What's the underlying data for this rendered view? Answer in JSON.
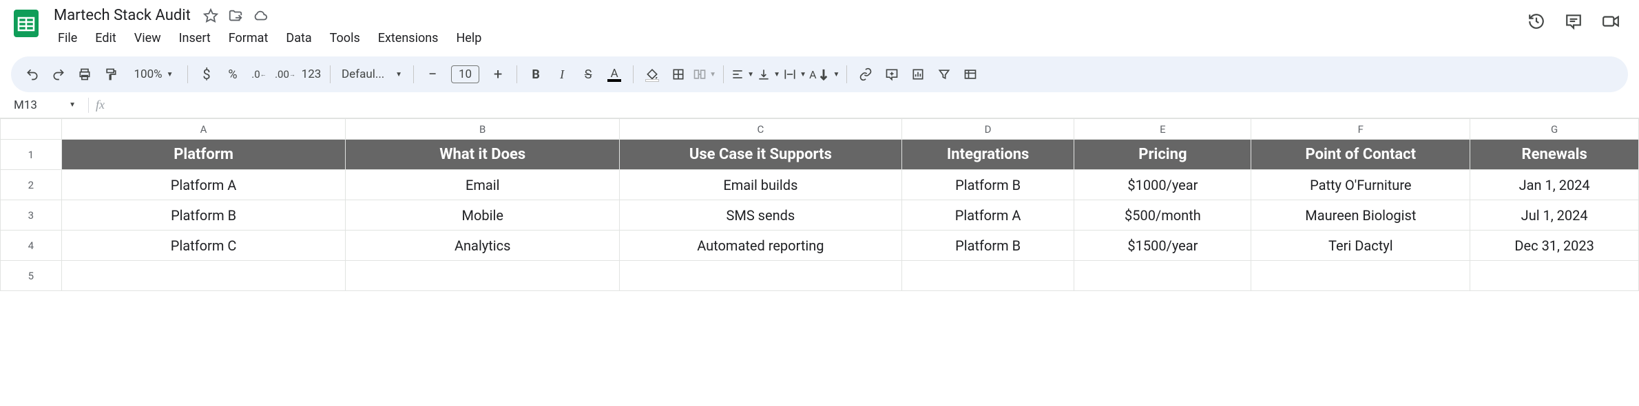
{
  "doc": {
    "title": "Martech Stack Audit"
  },
  "menus": [
    "File",
    "Edit",
    "View",
    "Insert",
    "Format",
    "Data",
    "Tools",
    "Extensions",
    "Help"
  ],
  "toolbar": {
    "zoom": "100%",
    "number_format": "123",
    "font": "Defaul...",
    "font_size": "10"
  },
  "namebox": {
    "cell": "M13"
  },
  "columns": [
    "A",
    "B",
    "C",
    "D",
    "E",
    "F",
    "G"
  ],
  "header_row": [
    "Platform",
    "What it Does",
    "Use Case it Supports",
    "Integrations",
    "Pricing",
    "Point of Contact",
    "Renewals"
  ],
  "rows": [
    {
      "n": "2",
      "cells": [
        "Platform A",
        "Email",
        "Email builds",
        "Platform B",
        "$1000/year",
        "Patty O'Furniture",
        "Jan 1, 2024"
      ]
    },
    {
      "n": "3",
      "cells": [
        "Platform B",
        "Mobile",
        "SMS sends",
        "Platform A",
        "$500/month",
        "Maureen Biologist",
        "Jul 1, 2024"
      ]
    },
    {
      "n": "4",
      "cells": [
        "Platform C",
        "Analytics",
        "Automated reporting",
        "Platform B",
        "$1500/year",
        "Teri Dactyl",
        "Dec 31, 2023"
      ]
    }
  ],
  "row_labels": [
    "1",
    "2",
    "3",
    "4",
    "5"
  ]
}
